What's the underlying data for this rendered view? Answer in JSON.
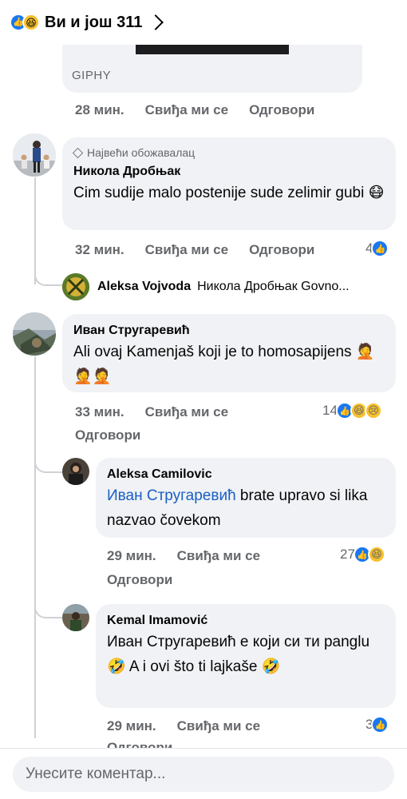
{
  "header": {
    "title": "Ви и још 311",
    "icons": [
      "like-icon",
      "haha-icon"
    ]
  },
  "giphy": {
    "label": "GIPHY"
  },
  "gif_actions": {
    "time": "28 мин.",
    "like": "Свиђа ми се",
    "reply": "Одговори"
  },
  "comments": [
    {
      "badge": "Највећи обожавалац",
      "author": "Никола Дробњак",
      "text": "Cim sudije malo postenije sude zelimir gubi 😷",
      "time": "32 мин.",
      "like": "Свиђа ми се",
      "reply": "Одговори",
      "reaction_count": "4",
      "reply_preview": {
        "author": "Aleksa Vojvoda",
        "text": "Никола Дробњак Govno..."
      }
    },
    {
      "author": "Иван Стругаревић",
      "text": "Ali ovaj Kamenjaš koji je to homosapijens 🤦🤦🤦",
      "time": "33 мин.",
      "like": "Свиђа ми се",
      "reply": "Одговори",
      "reaction_count": "14",
      "replies": [
        {
          "author": "Aleksa Camilovic",
          "mention": "Иван Стругаревић",
          "text": " brate upravo si lika nazvao čovekom",
          "time": "29 мин.",
          "like": "Свиђа ми се",
          "reply": "Одговори",
          "reaction_count": "27"
        },
        {
          "author": "Kemal Imamović",
          "text": "Иван Стругаревић е који си ти panglu 🤣 A i ovi što ti lajkaše 🤣",
          "time": "29 мин.",
          "like": "Свиђа ми се",
          "reply": "Одговори",
          "reaction_count": "3"
        }
      ]
    }
  ],
  "composer": {
    "placeholder": "Унесите коментар..."
  },
  "colors": {
    "like": "#1877f2",
    "bubble": "#f0f2f5",
    "secondary_text": "#65676b",
    "mention": "#1a5fc4"
  }
}
